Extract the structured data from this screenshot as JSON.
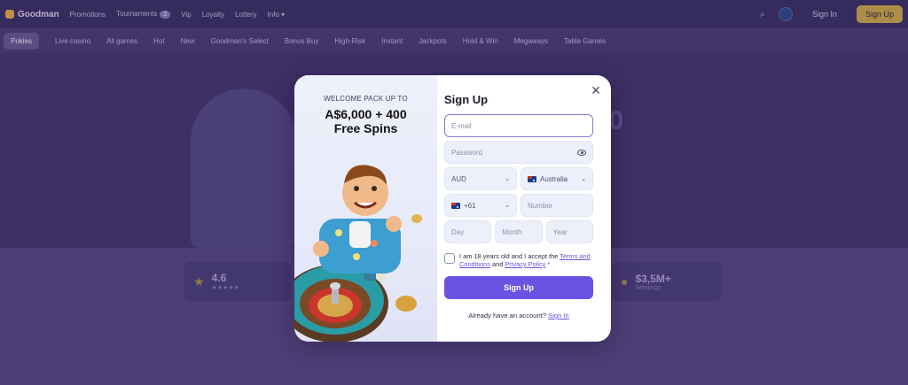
{
  "app": {
    "brand": "Goodman",
    "nav": [
      "Promotions",
      "Tournaments",
      "Vip",
      "Loyalty",
      "Lottery",
      "Info"
    ],
    "tournaments_badge": "2",
    "signin": "Sign In",
    "signup": "Sign Up"
  },
  "categories": [
    "Pokies",
    "Live casino",
    "All games",
    "Hot",
    "New",
    "Goodman's Select",
    "Bonus Buy",
    "High-Risk",
    "Instant",
    "Jackpots",
    "Hold & Win",
    "Megaways",
    "Table Games"
  ],
  "hero": {
    "amount_fragment": "00"
  },
  "stats": [
    {
      "value": "4.6",
      "sub": "★★★★★"
    },
    {
      "value": "$3,5M+",
      "sub": "Winnings"
    }
  ],
  "modal": {
    "promo_kicker": "WELCOME PACK UP TO",
    "promo_title_line1": "A$6,000 + 400",
    "promo_title_line2": "Free Spins",
    "title": "Sign Up",
    "email_placeholder": "E-mail",
    "password_placeholder": "Password",
    "currency": "AUD",
    "country": "Australia",
    "dial_code": "+61",
    "number_placeholder": "Number",
    "day_placeholder": "Day",
    "month_placeholder": "Month",
    "year_placeholder": "Year",
    "terms_prefix": "I am 18 years old and I accept the ",
    "terms_link": "Terms and Conditions",
    "terms_mid": " and ",
    "privacy_link": "Privacy Policy",
    "terms_req": " *",
    "submit": "Sign Up",
    "already_text": "Already have an account? ",
    "already_link": "Sign In"
  }
}
